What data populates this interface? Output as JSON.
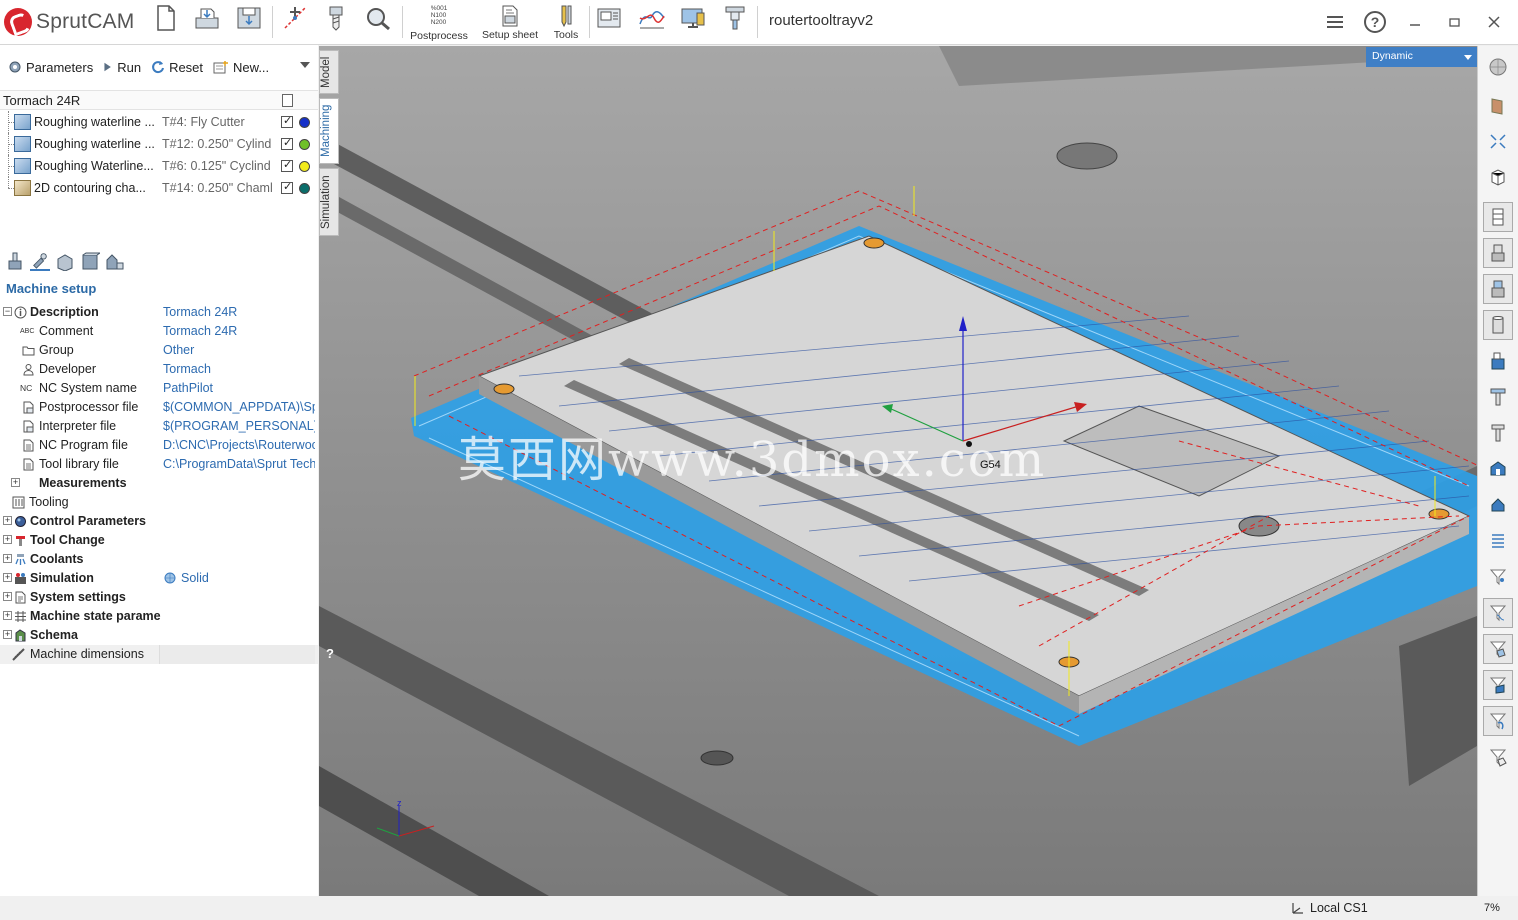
{
  "app": {
    "name": "SprutCAM",
    "document_title": "routertooltrayv2"
  },
  "toolbar": {
    "postprocess_label": "Postprocess",
    "postprocess_lines": [
      "%001",
      "N100",
      "N200"
    ],
    "setup_sheet_label": "Setup sheet",
    "tools_label": "Tools"
  },
  "ops_toolbar": {
    "parameters": "Parameters",
    "run": "Run",
    "reset": "Reset",
    "new": "New..."
  },
  "machine": {
    "name": "Tormach 24R"
  },
  "operations": [
    {
      "name": "Roughing waterline ...",
      "tool": "T#4: Fly Cutter",
      "color": "#1530c8"
    },
    {
      "name": "Roughing waterline ...",
      "tool": "T#12: 0.250\" Cylind",
      "color": "#6fc02a"
    },
    {
      "name": "Roughing Waterline...",
      "tool": "T#6: 0.125\" Cyclind",
      "color": "#f2ea1c"
    },
    {
      "name": "2D contouring cha...",
      "tool": "T#14: 0.250\" Chaml",
      "color": "#0a6d6a"
    }
  ],
  "section_title": "Machine setup",
  "properties": [
    {
      "name": "Description",
      "value": "Tormach 24R",
      "bold": true,
      "exp": "-",
      "icon": "info-icon"
    },
    {
      "name": "Comment",
      "value": "Tormach 24R",
      "icon": "abc-icon",
      "prefix": "ABC"
    },
    {
      "name": "Group",
      "value": "Other",
      "icon": "folder-icon"
    },
    {
      "name": "Developer",
      "value": "Tormach",
      "icon": "person-icon"
    },
    {
      "name": "NC System name",
      "value": "PathPilot",
      "icon": "nc-icon",
      "prefix": "NC"
    },
    {
      "name": "Postprocessor file",
      "value": "$(COMMON_APPDATA)\\Spr",
      "icon": "file-icon"
    },
    {
      "name": "Interpreter file",
      "value": "$(PROGRAM_PERSONAL)\\",
      "icon": "file-icon"
    },
    {
      "name": "NC Program file",
      "value": "D:\\CNC\\Projects\\Routerwoc",
      "icon": "file-icon"
    },
    {
      "name": "Tool library file",
      "value": "C:\\ProgramData\\Sprut Tech",
      "icon": "file-icon"
    },
    {
      "name": "Measurements",
      "value": "",
      "bold": true,
      "exp": "+"
    },
    {
      "name": "Tooling",
      "value": "",
      "icon": "tooling-icon"
    },
    {
      "name": "Control Parameters",
      "value": "",
      "bold": true,
      "exp": "+",
      "icon": "control-icon"
    },
    {
      "name": "Tool Change",
      "value": "",
      "bold": true,
      "exp": "+",
      "icon": "tool-change-icon"
    },
    {
      "name": "Coolants",
      "value": "",
      "bold": true,
      "exp": "+",
      "icon": "coolant-icon"
    },
    {
      "name": "Simulation",
      "value": "Solid",
      "bold": true,
      "exp": "+",
      "icon": "simulation-icon"
    },
    {
      "name": "System settings",
      "value": "",
      "bold": true,
      "exp": "+",
      "icon": "settings-icon"
    },
    {
      "name": "Machine state parame",
      "value": "",
      "bold": true,
      "exp": "+",
      "icon": "state-icon"
    },
    {
      "name": "Schema",
      "value": "",
      "bold": true,
      "exp": "+",
      "icon": "schema-icon"
    },
    {
      "name": "Machine dimensions",
      "value": "",
      "icon": "ruler-icon"
    }
  ],
  "side_tabs": [
    "Model",
    "Machining",
    "Simulation"
  ],
  "view": {
    "mode": "Dynamic",
    "cs_label": "G54",
    "help": "?",
    "watermark": "莫西网www.3dmox.com"
  },
  "status": {
    "coordinate_system": "Local CS1",
    "zoom": "7%"
  }
}
